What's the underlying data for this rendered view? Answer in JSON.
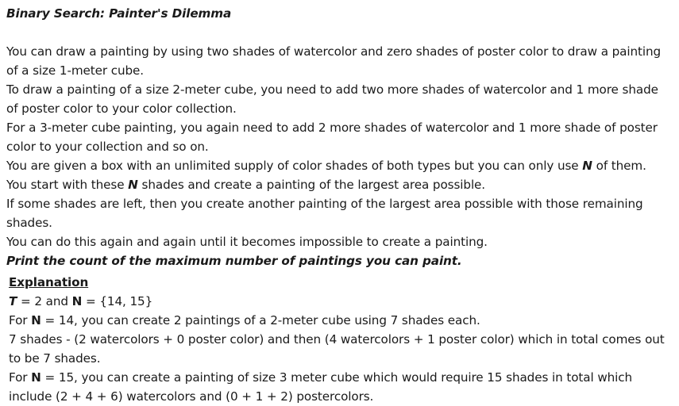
{
  "title": "Binary Search: Painter's Dilemma",
  "statement": {
    "p1": "You can draw a painting by using two shades of watercolor and zero shades of poster color to draw a painting of a size 1-meter cube.",
    "p2": "To draw a painting of a size 2-meter cube, you need to add two more shades of watercolor and 1 more shade of poster color to your color collection.",
    "p3": "For a 3-meter cube painting, you again need to add 2 more shades of watercolor and 1 more shade of poster color to your collection and so on.",
    "p4_before": "You are given a box with an unlimited supply of color shades of both types but you can only use ",
    "p4_var": "N",
    "p4_after": " of them.",
    "p5_before": "You start with these ",
    "p5_var": "N",
    "p5_after": " shades and create a painting of the largest area possible.",
    "p6": "If some shades are left, then you create another painting of the largest area possible with those remaining shades.",
    "p7": "You can do this again and again until it becomes impossible to create a painting.",
    "p8": "Print the count of the maximum number of paintings you can paint."
  },
  "explanation": {
    "heading": "Explanation",
    "l1_t": "T",
    "l1_mid": " = 2 and ",
    "l1_n": "N",
    "l1_after": " = {14, 15}",
    "l2_before": "For ",
    "l2_n": "N",
    "l2_after": " = 14, you can create 2 paintings of a 2-meter cube using 7 shades each.",
    "l3": "7 shades - (2 watercolors + 0 poster color) and then (4 watercolors + 1 poster color) which in total comes out to be 7 shades.",
    "l4_before": "For ",
    "l4_n": "N",
    "l4_after": " = 15, you can create a painting of size 3 meter cube which would require 15 shades in total which include (2 + 4 + 6) watercolors and (0 + 1 + 2) postercolors."
  }
}
